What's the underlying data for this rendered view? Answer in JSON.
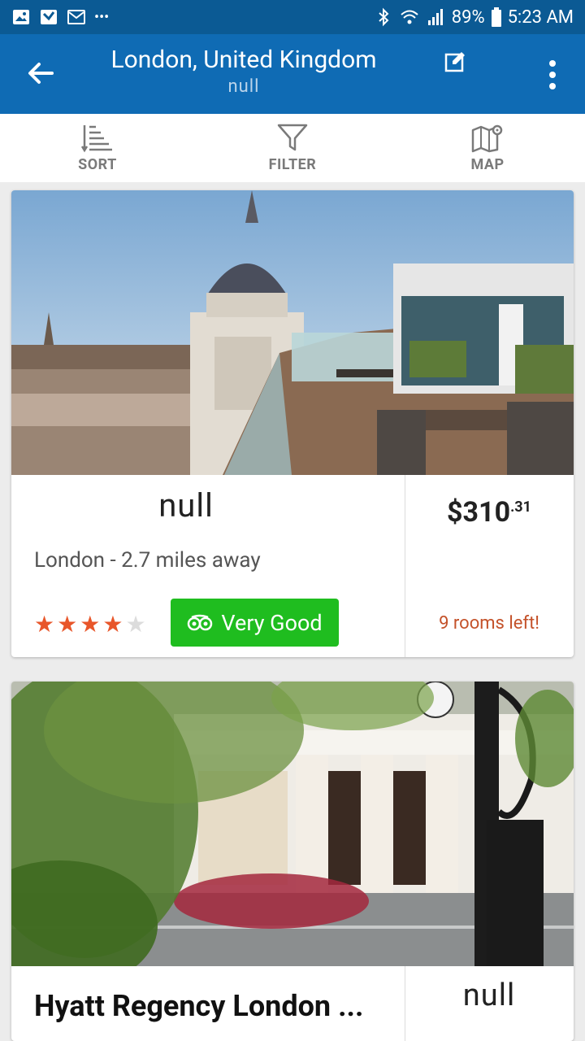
{
  "status_bar": {
    "battery": "89%",
    "time": "5:23 AM",
    "more": "•••"
  },
  "app_bar": {
    "title": "London, United Kingdom",
    "subtitle": "null"
  },
  "toolbar": {
    "sort_label": "SORT",
    "filter_label": "FILTER",
    "map_label": "MAP"
  },
  "hotels": [
    {
      "name": "null",
      "location": "London - 2.7 miles away",
      "star_rating": 4,
      "star_max": 5,
      "review_label": "Very Good",
      "price_main": "$310",
      "price_cents": ".31",
      "rooms_left": "9 rooms left!"
    },
    {
      "name": "Hyatt Regency London ...",
      "price_main": "null"
    }
  ],
  "colors": {
    "status_bar": "#0b5a94",
    "app_bar": "#0f6bb4",
    "rating_green": "#1fbd1f",
    "star_orange": "#e8562a",
    "rooms_left_orange": "#c4522a"
  }
}
